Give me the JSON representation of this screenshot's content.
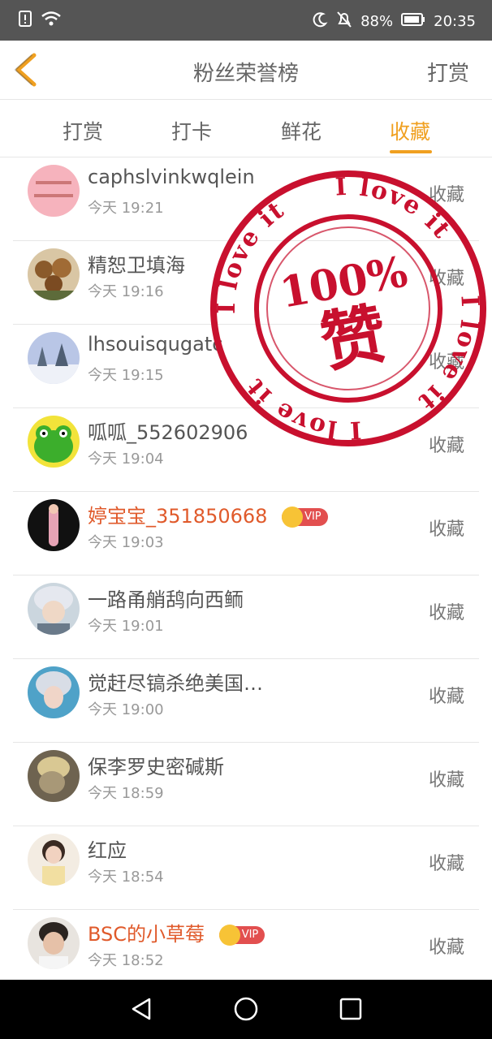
{
  "status": {
    "battery": "88%",
    "time": "20:35"
  },
  "header": {
    "title": "粉丝荣誉榜",
    "reward_link": "打赏"
  },
  "tabs": [
    {
      "label": "打赏"
    },
    {
      "label": "打卡"
    },
    {
      "label": "鲜花"
    },
    {
      "label": "收藏",
      "active": true
    }
  ],
  "items": [
    {
      "name": "caphslvinkwqlein",
      "time": "今天 19:21",
      "action": "收藏"
    },
    {
      "name": "精恕卫填海",
      "time": "今天 19:16",
      "action": "收藏"
    },
    {
      "name": "lhsouisqugatc",
      "time": "今天 19:15",
      "action": "收藏"
    },
    {
      "name": "呱呱_552602906",
      "time": "今天 19:04",
      "action": "收藏"
    },
    {
      "name": "婷宝宝_351850668",
      "time": "今天 19:03",
      "action": "收藏",
      "vip": true,
      "vip_label": "VIP"
    },
    {
      "name": "一路甬艄鸹向西鲕",
      "time": "今天 19:01",
      "action": "收藏"
    },
    {
      "name": "觉赶尽镐杀绝美国…",
      "time": "今天 19:00",
      "action": "收藏"
    },
    {
      "name": "保李罗史密碱斯",
      "time": "今天 18:59",
      "action": "收藏"
    },
    {
      "name": "红应",
      "time": "今天 18:54",
      "action": "收藏"
    },
    {
      "name": "BSC的小草莓",
      "time": "今天 18:52",
      "action": "收藏",
      "vip": true,
      "vip_label": "VIP"
    }
  ],
  "stamp": {
    "ring_text": "I love it",
    "percent": "100%",
    "char": "赞"
  },
  "colors": {
    "accent": "#f0a020",
    "vip_name": "#e05a2b",
    "stamp_red": "#c8102e"
  }
}
